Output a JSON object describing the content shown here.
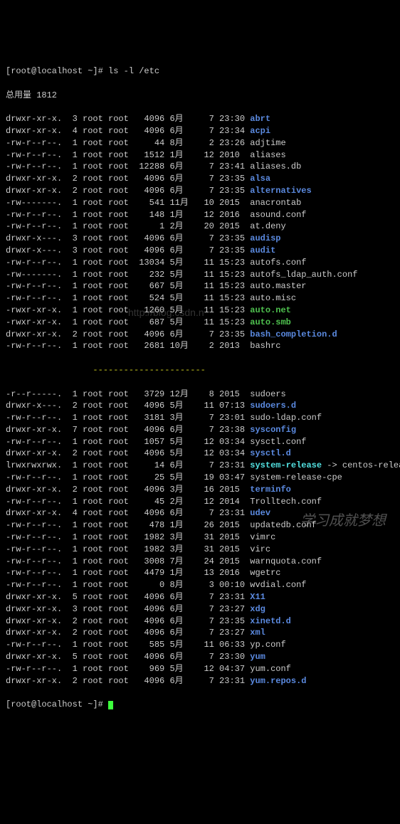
{
  "prompt_top": "[root@localhost ~]# ls -l /etc",
  "total_line": "总用量 1812",
  "separator": "                 ----------------------",
  "prompt_bottom": "[root@localhost ~]# ",
  "watermark": "http://blog.csdn.n",
  "caption": "学习成就梦想",
  "rows_top": [
    {
      "perm": "drwxr-xr-x.",
      "n": "3",
      "o": "root",
      "g": "root",
      "sz": "4096",
      "mo": "6月",
      "d": "7",
      "t": "23:30",
      "name": "abrt",
      "cls": "dir"
    },
    {
      "perm": "drwxr-xr-x.",
      "n": "4",
      "o": "root",
      "g": "root",
      "sz": "4096",
      "mo": "6月",
      "d": "7",
      "t": "23:34",
      "name": "acpi",
      "cls": "dir"
    },
    {
      "perm": "-rw-r--r--.",
      "n": "1",
      "o": "root",
      "g": "root",
      "sz": "44",
      "mo": "8月",
      "d": "2",
      "t": "23:26",
      "name": "adjtime",
      "cls": "normal"
    },
    {
      "perm": "-rw-r--r--.",
      "n": "1",
      "o": "root",
      "g": "root",
      "sz": "1512",
      "mo": "1月",
      "d": "12",
      "t": "2010",
      "name": "aliases",
      "cls": "normal"
    },
    {
      "perm": "-rw-r--r--.",
      "n": "1",
      "o": "root",
      "g": "root",
      "sz": "12288",
      "mo": "6月",
      "d": "7",
      "t": "23:41",
      "name": "aliases.db",
      "cls": "normal"
    },
    {
      "perm": "drwxr-xr-x.",
      "n": "2",
      "o": "root",
      "g": "root",
      "sz": "4096",
      "mo": "6月",
      "d": "7",
      "t": "23:35",
      "name": "alsa",
      "cls": "dir"
    },
    {
      "perm": "drwxr-xr-x.",
      "n": "2",
      "o": "root",
      "g": "root",
      "sz": "4096",
      "mo": "6月",
      "d": "7",
      "t": "23:35",
      "name": "alternatives",
      "cls": "dir"
    },
    {
      "perm": "-rw-------.",
      "n": "1",
      "o": "root",
      "g": "root",
      "sz": "541",
      "mo": "11月",
      "d": "10",
      "t": "2015",
      "name": "anacrontab",
      "cls": "normal"
    },
    {
      "perm": "-rw-r--r--.",
      "n": "1",
      "o": "root",
      "g": "root",
      "sz": "148",
      "mo": "1月",
      "d": "12",
      "t": "2016",
      "name": "asound.conf",
      "cls": "normal"
    },
    {
      "perm": "-rw-r--r--.",
      "n": "1",
      "o": "root",
      "g": "root",
      "sz": "1",
      "mo": "2月",
      "d": "20",
      "t": "2015",
      "name": "at.deny",
      "cls": "normal"
    },
    {
      "perm": "drwxr-x---.",
      "n": "3",
      "o": "root",
      "g": "root",
      "sz": "4096",
      "mo": "6月",
      "d": "7",
      "t": "23:35",
      "name": "audisp",
      "cls": "dir"
    },
    {
      "perm": "drwxr-x---.",
      "n": "3",
      "o": "root",
      "g": "root",
      "sz": "4096",
      "mo": "6月",
      "d": "7",
      "t": "23:35",
      "name": "audit",
      "cls": "dir"
    },
    {
      "perm": "-rw-r--r--.",
      "n": "1",
      "o": "root",
      "g": "root",
      "sz": "13034",
      "mo": "5月",
      "d": "11",
      "t": "15:23",
      "name": "autofs.conf",
      "cls": "normal"
    },
    {
      "perm": "-rw-------.",
      "n": "1",
      "o": "root",
      "g": "root",
      "sz": "232",
      "mo": "5月",
      "d": "11",
      "t": "15:23",
      "name": "autofs_ldap_auth.conf",
      "cls": "normal"
    },
    {
      "perm": "-rw-r--r--.",
      "n": "1",
      "o": "root",
      "g": "root",
      "sz": "667",
      "mo": "5月",
      "d": "11",
      "t": "15:23",
      "name": "auto.master",
      "cls": "normal"
    },
    {
      "perm": "-rw-r--r--.",
      "n": "1",
      "o": "root",
      "g": "root",
      "sz": "524",
      "mo": "5月",
      "d": "11",
      "t": "15:23",
      "name": "auto.misc",
      "cls": "normal"
    },
    {
      "perm": "-rwxr-xr-x.",
      "n": "1",
      "o": "root",
      "g": "root",
      "sz": "1260",
      "mo": "5月",
      "d": "11",
      "t": "15:23",
      "name": "auto.net",
      "cls": "exe"
    },
    {
      "perm": "-rwxr-xr-x.",
      "n": "1",
      "o": "root",
      "g": "root",
      "sz": "687",
      "mo": "5月",
      "d": "11",
      "t": "15:23",
      "name": "auto.smb",
      "cls": "exe"
    },
    {
      "perm": "drwxr-xr-x.",
      "n": "2",
      "o": "root",
      "g": "root",
      "sz": "4096",
      "mo": "6月",
      "d": "7",
      "t": "23:35",
      "name": "bash_completion.d",
      "cls": "dir"
    },
    {
      "perm": "-rw-r--r--.",
      "n": "1",
      "o": "root",
      "g": "root",
      "sz": "2681",
      "mo": "10月",
      "d": "2",
      "t": "2013",
      "name": "bashrc",
      "cls": "normal"
    }
  ],
  "rows_bottom": [
    {
      "perm": "-r--r-----.",
      "n": "1",
      "o": "root",
      "g": "root",
      "sz": "3729",
      "mo": "12月",
      "d": "8",
      "t": "2015",
      "name": "sudoers",
      "cls": "normal"
    },
    {
      "perm": "drwxr-x---.",
      "n": "2",
      "o": "root",
      "g": "root",
      "sz": "4096",
      "mo": "5月",
      "d": "11",
      "t": "07:13",
      "name": "sudoers.d",
      "cls": "dir"
    },
    {
      "perm": "-rw-r--r--.",
      "n": "1",
      "o": "root",
      "g": "root",
      "sz": "3181",
      "mo": "3月",
      "d": "7",
      "t": "23:01",
      "name": "sudo-ldap.conf",
      "cls": "normal"
    },
    {
      "perm": "drwxr-xr-x.",
      "n": "7",
      "o": "root",
      "g": "root",
      "sz": "4096",
      "mo": "6月",
      "d": "7",
      "t": "23:38",
      "name": "sysconfig",
      "cls": "dir"
    },
    {
      "perm": "-rw-r--r--.",
      "n": "1",
      "o": "root",
      "g": "root",
      "sz": "1057",
      "mo": "5月",
      "d": "12",
      "t": "03:34",
      "name": "sysctl.conf",
      "cls": "normal"
    },
    {
      "perm": "drwxr-xr-x.",
      "n": "2",
      "o": "root",
      "g": "root",
      "sz": "4096",
      "mo": "5月",
      "d": "12",
      "t": "03:34",
      "name": "sysctl.d",
      "cls": "dir"
    },
    {
      "perm": "lrwxrwxrwx.",
      "n": "1",
      "o": "root",
      "g": "root",
      "sz": "14",
      "mo": "6月",
      "d": "7",
      "t": "23:31",
      "name": "system-release",
      "cls": "lnk",
      "arrow": " -> centos-release"
    },
    {
      "perm": "-rw-r--r--.",
      "n": "1",
      "o": "root",
      "g": "root",
      "sz": "25",
      "mo": "5月",
      "d": "19",
      "t": "03:47",
      "name": "system-release-cpe",
      "cls": "normal"
    },
    {
      "perm": "drwxr-xr-x.",
      "n": "2",
      "o": "root",
      "g": "root",
      "sz": "4096",
      "mo": "3月",
      "d": "16",
      "t": "2015",
      "name": "terminfo",
      "cls": "dir"
    },
    {
      "perm": "-rw-r--r--.",
      "n": "1",
      "o": "root",
      "g": "root",
      "sz": "45",
      "mo": "2月",
      "d": "12",
      "t": "2014",
      "name": "Trolltech.conf",
      "cls": "normal"
    },
    {
      "perm": "drwxr-xr-x.",
      "n": "4",
      "o": "root",
      "g": "root",
      "sz": "4096",
      "mo": "6月",
      "d": "7",
      "t": "23:31",
      "name": "udev",
      "cls": "dir"
    },
    {
      "perm": "-rw-r--r--.",
      "n": "1",
      "o": "root",
      "g": "root",
      "sz": "478",
      "mo": "1月",
      "d": "26",
      "t": "2015",
      "name": "updatedb.conf",
      "cls": "normal"
    },
    {
      "perm": "-rw-r--r--.",
      "n": "1",
      "o": "root",
      "g": "root",
      "sz": "1982",
      "mo": "3月",
      "d": "31",
      "t": "2015",
      "name": "vimrc",
      "cls": "normal"
    },
    {
      "perm": "-rw-r--r--.",
      "n": "1",
      "o": "root",
      "g": "root",
      "sz": "1982",
      "mo": "3月",
      "d": "31",
      "t": "2015",
      "name": "virc",
      "cls": "normal"
    },
    {
      "perm": "-rw-r--r--.",
      "n": "1",
      "o": "root",
      "g": "root",
      "sz": "3008",
      "mo": "7月",
      "d": "24",
      "t": "2015",
      "name": "warnquota.conf",
      "cls": "normal"
    },
    {
      "perm": "-rw-r--r--.",
      "n": "1",
      "o": "root",
      "g": "root",
      "sz": "4479",
      "mo": "1月",
      "d": "13",
      "t": "2016",
      "name": "wgetrc",
      "cls": "normal"
    },
    {
      "perm": "-rw-r--r--.",
      "n": "1",
      "o": "root",
      "g": "root",
      "sz": "0",
      "mo": "8月",
      "d": "3",
      "t": "00:10",
      "name": "wvdial.conf",
      "cls": "normal"
    },
    {
      "perm": "drwxr-xr-x.",
      "n": "5",
      "o": "root",
      "g": "root",
      "sz": "4096",
      "mo": "6月",
      "d": "7",
      "t": "23:31",
      "name": "X11",
      "cls": "dir"
    },
    {
      "perm": "drwxr-xr-x.",
      "n": "3",
      "o": "root",
      "g": "root",
      "sz": "4096",
      "mo": "6月",
      "d": "7",
      "t": "23:27",
      "name": "xdg",
      "cls": "dir"
    },
    {
      "perm": "drwxr-xr-x.",
      "n": "2",
      "o": "root",
      "g": "root",
      "sz": "4096",
      "mo": "6月",
      "d": "7",
      "t": "23:35",
      "name": "xinetd.d",
      "cls": "dir"
    },
    {
      "perm": "drwxr-xr-x.",
      "n": "2",
      "o": "root",
      "g": "root",
      "sz": "4096",
      "mo": "6月",
      "d": "7",
      "t": "23:27",
      "name": "xml",
      "cls": "dir"
    },
    {
      "perm": "-rw-r--r--.",
      "n": "1",
      "o": "root",
      "g": "root",
      "sz": "585",
      "mo": "5月",
      "d": "11",
      "t": "06:33",
      "name": "yp.conf",
      "cls": "normal"
    },
    {
      "perm": "drwxr-xr-x.",
      "n": "5",
      "o": "root",
      "g": "root",
      "sz": "4096",
      "mo": "6月",
      "d": "7",
      "t": "23:30",
      "name": "yum",
      "cls": "dir"
    },
    {
      "perm": "-rw-r--r--.",
      "n": "1",
      "o": "root",
      "g": "root",
      "sz": "969",
      "mo": "5月",
      "d": "12",
      "t": "04:37",
      "name": "yum.conf",
      "cls": "normal"
    },
    {
      "perm": "drwxr-xr-x.",
      "n": "2",
      "o": "root",
      "g": "root",
      "sz": "4096",
      "mo": "6月",
      "d": "7",
      "t": "23:31",
      "name": "yum.repos.d",
      "cls": "dir"
    }
  ]
}
